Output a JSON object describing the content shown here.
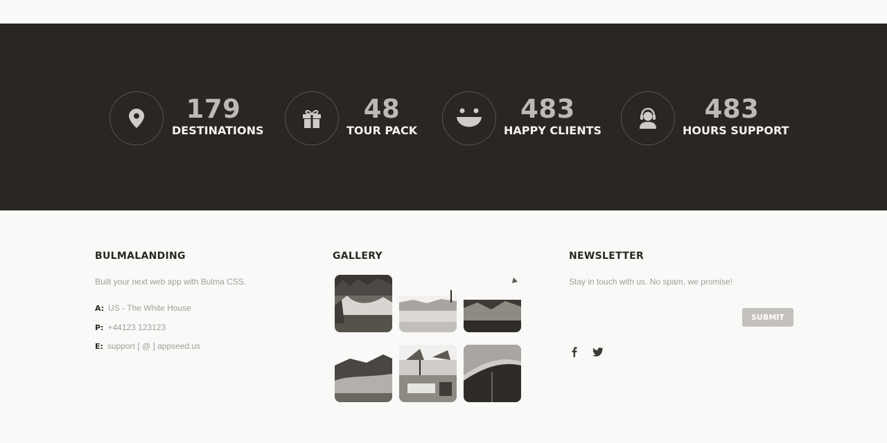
{
  "stats": [
    {
      "icon": "map-pin-icon",
      "number": "179",
      "label": "DESTINATIONS"
    },
    {
      "icon": "gift-icon",
      "number": "48",
      "label": "TOUR PACK"
    },
    {
      "icon": "smiley-icon",
      "number": "483",
      "label": "HAPPY CLIENTS"
    },
    {
      "icon": "support-agent-icon",
      "number": "483",
      "label": "HOURS SUPPORT"
    }
  ],
  "footer": {
    "about": {
      "title": "BULMALANDING",
      "text": "Built your next web app with Bulma CSS.",
      "address_key": "A:",
      "address": "US - The White House",
      "phone_key": "P:",
      "phone": "+44123 123123",
      "email_key": "E:",
      "email": "support [ @ ] appseed.us"
    },
    "gallery": {
      "title": "GALLERY",
      "images": [
        "forest-lake-photo",
        "lakeside-shore-photo",
        "mountain-valley-photo",
        "coastal-hills-photo",
        "beach-umbrellas-photo",
        "sailboat-sail-photo"
      ]
    },
    "newsletter": {
      "title": "NEWSLETTER",
      "text": "Stay in touch with us. No spam, we promise!",
      "input_placeholder": "",
      "submit_label": "SUBMIT"
    },
    "social": [
      "facebook-icon",
      "twitter-icon"
    ]
  },
  "colors": {
    "dark_band": "#2b2622",
    "page_bg": "#f9f9f8",
    "stat_number": "#bdbab6",
    "muted_text": "#a19d98",
    "button_bg": "#c4c1bd"
  }
}
